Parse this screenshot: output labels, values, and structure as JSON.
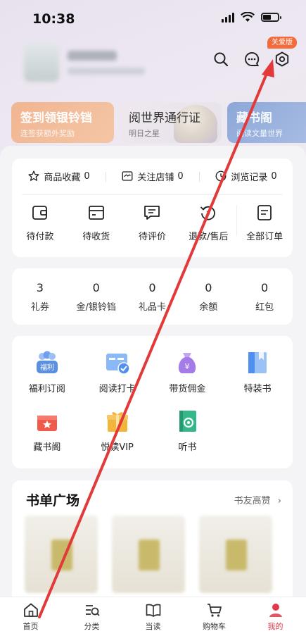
{
  "status_bar": {
    "time": "10:38"
  },
  "header": {
    "edition_badge": "关爱版",
    "icons": [
      "search-icon",
      "message-icon",
      "settings-icon"
    ]
  },
  "banners": [
    {
      "title": "签到领银铃铛",
      "subtitle": "连签获额外奖励"
    },
    {
      "title": "阅世界通行证",
      "subtitle": "明日之星"
    },
    {
      "title": "藏书阁",
      "subtitle": "阅读文量世界"
    }
  ],
  "quick_stats": [
    {
      "label": "商品收藏",
      "count": "0",
      "icon": "star-icon"
    },
    {
      "label": "关注店铺",
      "count": "0",
      "icon": "store-icon"
    },
    {
      "label": "浏览记录",
      "count": "0",
      "icon": "clock-icon"
    }
  ],
  "orders": [
    {
      "label": "待付款",
      "icon": "wallet-icon"
    },
    {
      "label": "待收货",
      "icon": "package-icon"
    },
    {
      "label": "待评价",
      "icon": "comment-icon"
    },
    {
      "label": "退款/售后",
      "icon": "refund-icon"
    },
    {
      "label": "全部订单",
      "icon": "order-list-icon"
    }
  ],
  "assets": [
    {
      "value": "3",
      "label": "礼券"
    },
    {
      "value": "0",
      "label": "金/银铃铛"
    },
    {
      "value": "0",
      "label": "礼品卡"
    },
    {
      "value": "0",
      "label": "余额"
    },
    {
      "value": "0",
      "label": "红包"
    }
  ],
  "services": [
    {
      "label": "福利订阅",
      "icon": "welfare-icon",
      "color": "#5b8fe0",
      "badge": "福利"
    },
    {
      "label": "阅读打卡",
      "icon": "reading-checkin-icon",
      "color": "#4f8ff0"
    },
    {
      "label": "带货佣金",
      "icon": "money-bag-icon",
      "color": "#a47be8"
    },
    {
      "label": "特装书",
      "icon": "special-book-icon",
      "color": "#4f8ff0"
    },
    {
      "label": "藏书阁",
      "icon": "gift-box-icon",
      "color": "#ef5a4a"
    },
    {
      "label": "悦读VIP",
      "icon": "vip-gift-icon",
      "color": "#f3b43c"
    },
    {
      "label": "听书",
      "icon": "audiobook-icon",
      "color": "#34b88a"
    }
  ],
  "booklist": {
    "title": "书单广场",
    "more": "书友高赞"
  },
  "tabbar": [
    {
      "label": "首页",
      "icon": "home-icon"
    },
    {
      "label": "分类",
      "icon": "category-icon"
    },
    {
      "label": "当读",
      "icon": "book-icon"
    },
    {
      "label": "购物车",
      "icon": "cart-icon"
    },
    {
      "label": "我的",
      "icon": "profile-icon",
      "active": true
    }
  ],
  "colors": {
    "accent": "#e0384d",
    "annotation_arrow": "#e23a3a",
    "badge": "#f36b3c"
  }
}
